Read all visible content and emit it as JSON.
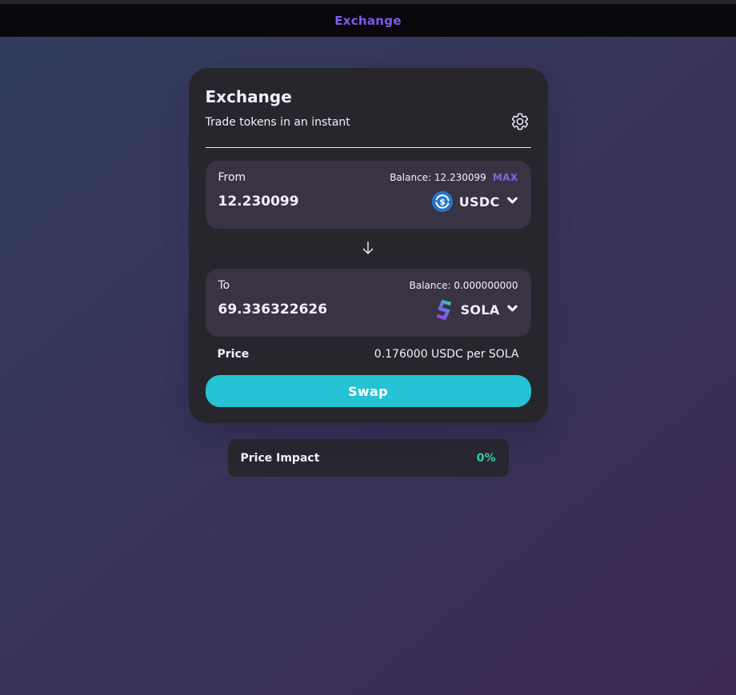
{
  "nav": {
    "title": "Exchange"
  },
  "card": {
    "title": "Exchange",
    "subtitle": "Trade tokens in an instant",
    "from": {
      "label": "From",
      "balance_label": "Balance: 12.230099",
      "max_label": "MAX",
      "value": "12.230099",
      "token": "USDC"
    },
    "to": {
      "label": "To",
      "balance_label": "Balance: 0.000000000",
      "value": "69.336322626",
      "token": "SOLA"
    },
    "price": {
      "label": "Price",
      "value": "0.176000 USDC per SOLA"
    },
    "swap_label": "Swap"
  },
  "details": {
    "price_impact_label": "Price Impact",
    "price_impact_value": "0%"
  },
  "icons": {
    "settings": "gear-icon",
    "from_token": "usdc-token-icon",
    "to_token": "sola-token-icon",
    "token_dropdown": "chevron-down-icon",
    "direction": "arrow-down-icon"
  },
  "colors": {
    "nav_accent": "#7F5AF0",
    "max_purple": "#7F68D8",
    "button_cyan": "#26C3D4",
    "success_green": "#31D0AA",
    "usdc_blue": "#2775CA",
    "card_bg": "#27262C",
    "panel_bg": "#393343",
    "background_start": "#313D5C",
    "background_end": "#3D2A54"
  }
}
